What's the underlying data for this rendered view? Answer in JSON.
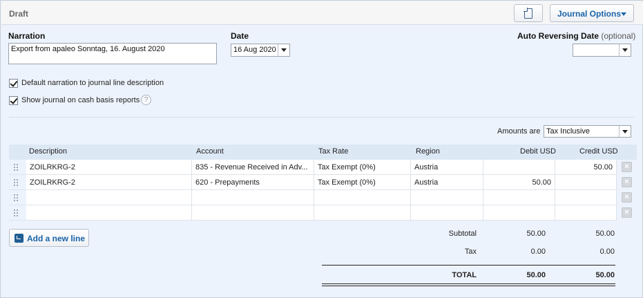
{
  "header": {
    "status": "Draft",
    "journal_options_label": "Journal Options",
    "icons": {
      "document": "document-icon",
      "caret": "chevron-down-icon"
    }
  },
  "form": {
    "narration_label": "Narration",
    "narration_value": "Export from apaleo Sonntag, 16. August 2020",
    "date_label": "Date",
    "date_value": "16 Aug 2020",
    "auto_reversing_label": "Auto Reversing Date",
    "auto_reversing_optional": "(optional)",
    "auto_reversing_value": "",
    "checkbox_default_narration": "Default narration to journal line description",
    "checkbox_cash_basis": "Show journal on cash basis reports",
    "help_glyph": "?",
    "amounts_are_label": "Amounts are",
    "amounts_are_value": "Tax Inclusive"
  },
  "table": {
    "columns": {
      "description": "Description",
      "account": "Account",
      "tax_rate": "Tax Rate",
      "region": "Region",
      "debit": "Debit USD",
      "credit": "Credit USD"
    },
    "rows": [
      {
        "description": "ZOILRKRG-2",
        "account": "835 - Revenue Received in Adv...",
        "tax_rate": "Tax Exempt (0%)",
        "region": "Austria",
        "debit": "",
        "credit": "50.00"
      },
      {
        "description": "ZOILRKRG-2",
        "account": "620 - Prepayments",
        "tax_rate": "Tax Exempt (0%)",
        "region": "Austria",
        "debit": "50.00",
        "credit": ""
      },
      {
        "description": "",
        "account": "",
        "tax_rate": "",
        "region": "",
        "debit": "",
        "credit": ""
      },
      {
        "description": "",
        "account": "",
        "tax_rate": "",
        "region": "",
        "debit": "",
        "credit": ""
      }
    ],
    "delete_glyph": "×"
  },
  "add_line_label": "Add a new line",
  "totals": {
    "subtotal_label": "Subtotal",
    "subtotal_debit": "50.00",
    "subtotal_credit": "50.00",
    "tax_label": "Tax",
    "tax_debit": "0.00",
    "tax_credit": "0.00",
    "total_label": "TOTAL",
    "total_debit": "50.00",
    "total_credit": "50.00"
  }
}
